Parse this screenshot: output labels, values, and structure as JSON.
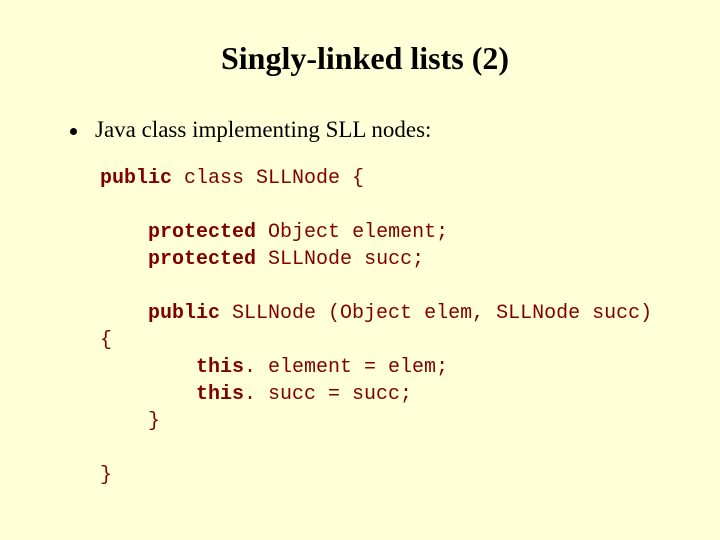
{
  "title": "Singly-linked lists (2)",
  "bullet": "Java class implementing SLL nodes:",
  "code": {
    "l1a": "public",
    "l1b": " class SLLNode {",
    "l2a": "protected",
    "l2b": " Object element;",
    "l3a": "protected",
    "l3b": " SLLNode succ;",
    "l4a": "public",
    "l4b": " SLLNode (Object elem, SLLNode succ)",
    "l5": "{",
    "l6a": "this",
    "l6b": ". element = elem;",
    "l7a": "this",
    "l7b": ". succ = succ;",
    "l8": "}",
    "l9": "}"
  }
}
